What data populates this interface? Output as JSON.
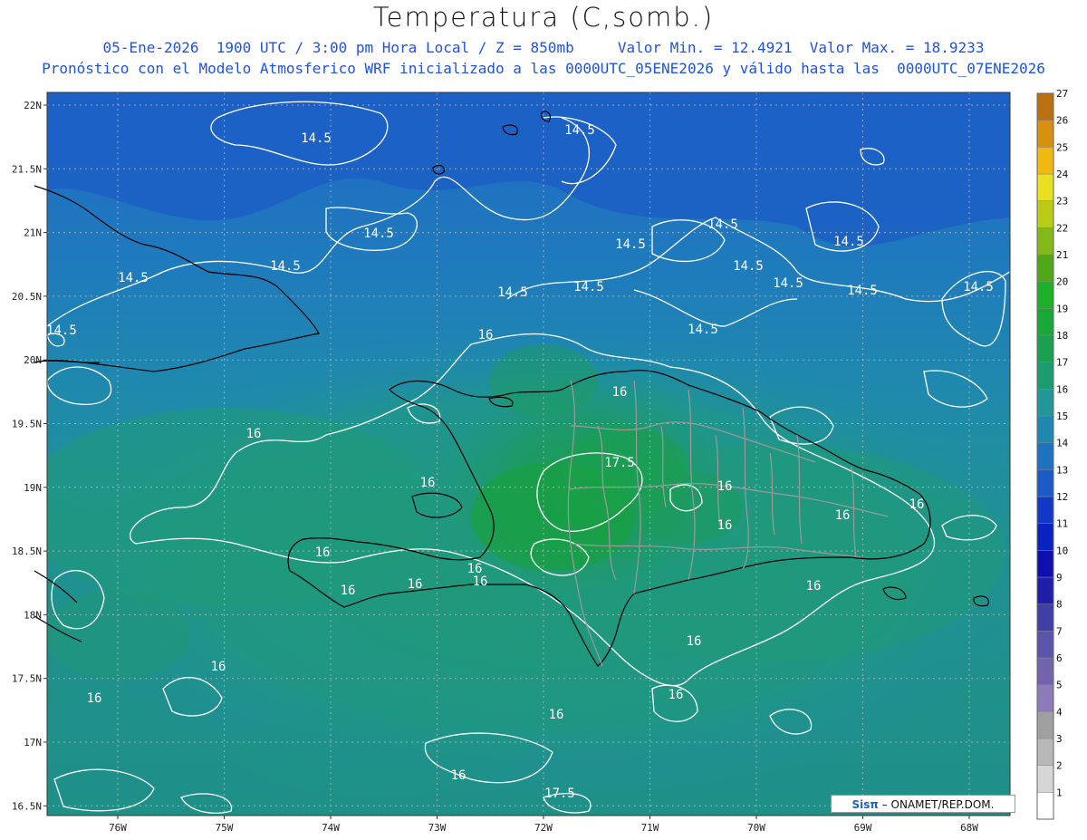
{
  "header": {
    "title": "Temperatura (C,somb.)",
    "line1": "05-Ene-2026  1900 UTC / 3:00 pm Hora Local / Z = 850mb     Valor Min. = 12.4921  Valor Max. = 18.9233",
    "line2": "Pronóstico con el Modelo Atmosferico WRF inicializado a las 0000UTC_05ENE2026 y válido hasta las  0000UTC_07ENE2026"
  },
  "axes": {
    "lat_labels": [
      "22N",
      "21.5N",
      "21N",
      "20.5N",
      "20N",
      "19.5N",
      "19N",
      "18.5N",
      "18N",
      "17.5N",
      "17N",
      "16.5N"
    ],
    "lon_labels": [
      "76W",
      "75W",
      "74W",
      "73W",
      "72W",
      "71W",
      "70W",
      "69W",
      "68W"
    ]
  },
  "colorbar": {
    "labels": [
      "1",
      "2",
      "3",
      "4",
      "5",
      "6",
      "7",
      "8",
      "9",
      "10",
      "11",
      "12",
      "13",
      "14",
      "15",
      "16",
      "17",
      "18",
      "19",
      "20",
      "21",
      "22",
      "23",
      "24",
      "25",
      "26",
      "27"
    ],
    "colors": [
      "#ffffff",
      "#d6d6d6",
      "#b8b8b8",
      "#a0a0a0",
      "#8d7bb8",
      "#7164ad",
      "#5a55aa",
      "#3f3fa6",
      "#1e1ea8",
      "#0f0fb0",
      "#0a22c0",
      "#1238c8",
      "#1c5ac8",
      "#1f72c0",
      "#1f88b0",
      "#22979a",
      "#1c9a70",
      "#1aa050",
      "#18a838",
      "#1eb028",
      "#50a818",
      "#82b818",
      "#b8cc18",
      "#e8e020",
      "#f0b810",
      "#d89010",
      "#b87010"
    ]
  },
  "contour_labels": [
    {
      "text": "14.5"
    },
    {
      "text": "14.5"
    },
    {
      "text": "14.5"
    },
    {
      "text": "14.5"
    },
    {
      "text": "14.5"
    },
    {
      "text": "14.5"
    },
    {
      "text": "14.5"
    },
    {
      "text": "14.5"
    },
    {
      "text": "14.5"
    },
    {
      "text": "14.5"
    },
    {
      "text": "14.5"
    },
    {
      "text": "14.5"
    },
    {
      "text": "14.5"
    },
    {
      "text": "14.5"
    },
    {
      "text": "14.5"
    },
    {
      "text": "14.5"
    },
    {
      "text": "16"
    },
    {
      "text": "16"
    },
    {
      "text": "16"
    },
    {
      "text": "16"
    },
    {
      "text": "16"
    },
    {
      "text": "16"
    },
    {
      "text": "16"
    },
    {
      "text": "16"
    },
    {
      "text": "16"
    },
    {
      "text": "16"
    },
    {
      "text": "16"
    },
    {
      "text": "16"
    },
    {
      "text": "16"
    },
    {
      "text": "16"
    },
    {
      "text": "16"
    },
    {
      "text": "16"
    },
    {
      "text": "16"
    },
    {
      "text": "16"
    },
    {
      "text": "16"
    },
    {
      "text": "16"
    },
    {
      "text": "17.5"
    },
    {
      "text": "17.5"
    }
  ],
  "credit": {
    "brand": "Sisπ",
    "text": " – ONAMET/REP.DOM."
  }
}
